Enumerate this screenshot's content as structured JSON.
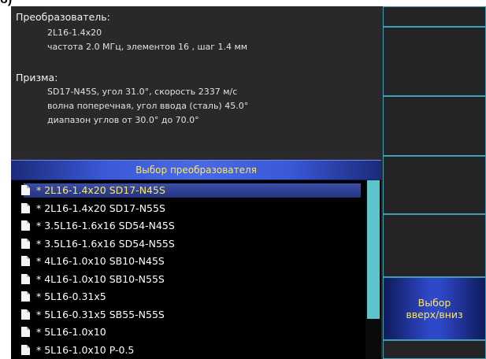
{
  "corner_label": "б)",
  "transducer": {
    "heading": "Преобразователь:",
    "model": "2L16-1.4x20",
    "params": "частота 2.0 МГц, элементов 16 , шаг 1.4 мм"
  },
  "prism": {
    "heading": "Призма:",
    "line1": "SD17-N45S,  угол 31.0°, скорость 2337 м/с",
    "line2": "волна поперечная, угол ввода (сталь) 45.0°",
    "line3": "диапазон углов от 30.0° до 70.0°"
  },
  "list": {
    "title": "Выбор преобразователя",
    "items": [
      {
        "label": "* 2L16-1.4x20 SD17-N45S",
        "selected": true
      },
      {
        "label": "* 2L16-1.4x20 SD17-N55S",
        "selected": false
      },
      {
        "label": "* 3.5L16-1.6x16 SD54-N45S",
        "selected": false
      },
      {
        "label": "* 3.5L16-1.6x16 SD54-N55S",
        "selected": false
      },
      {
        "label": "* 4L16-1.0x10 SB10-N45S",
        "selected": false
      },
      {
        "label": "* 4L16-1.0x10 SB10-N55S",
        "selected": false
      },
      {
        "label": "* 5L16-0.31x5",
        "selected": false
      },
      {
        "label": "* 5L16-0.31x5 SB55-N55S",
        "selected": false
      },
      {
        "label": "* 5L16-1.0x10",
        "selected": false
      },
      {
        "label": "* 5L16-1.0x10 P-0.5",
        "selected": false
      }
    ]
  },
  "side_button": {
    "line1": "Выбор",
    "line2": "вверх/вниз"
  },
  "colors": {
    "highlight_text": "#ffe860",
    "accent_border": "#3f9fb5",
    "scrollbar": "#5ec4cc"
  }
}
